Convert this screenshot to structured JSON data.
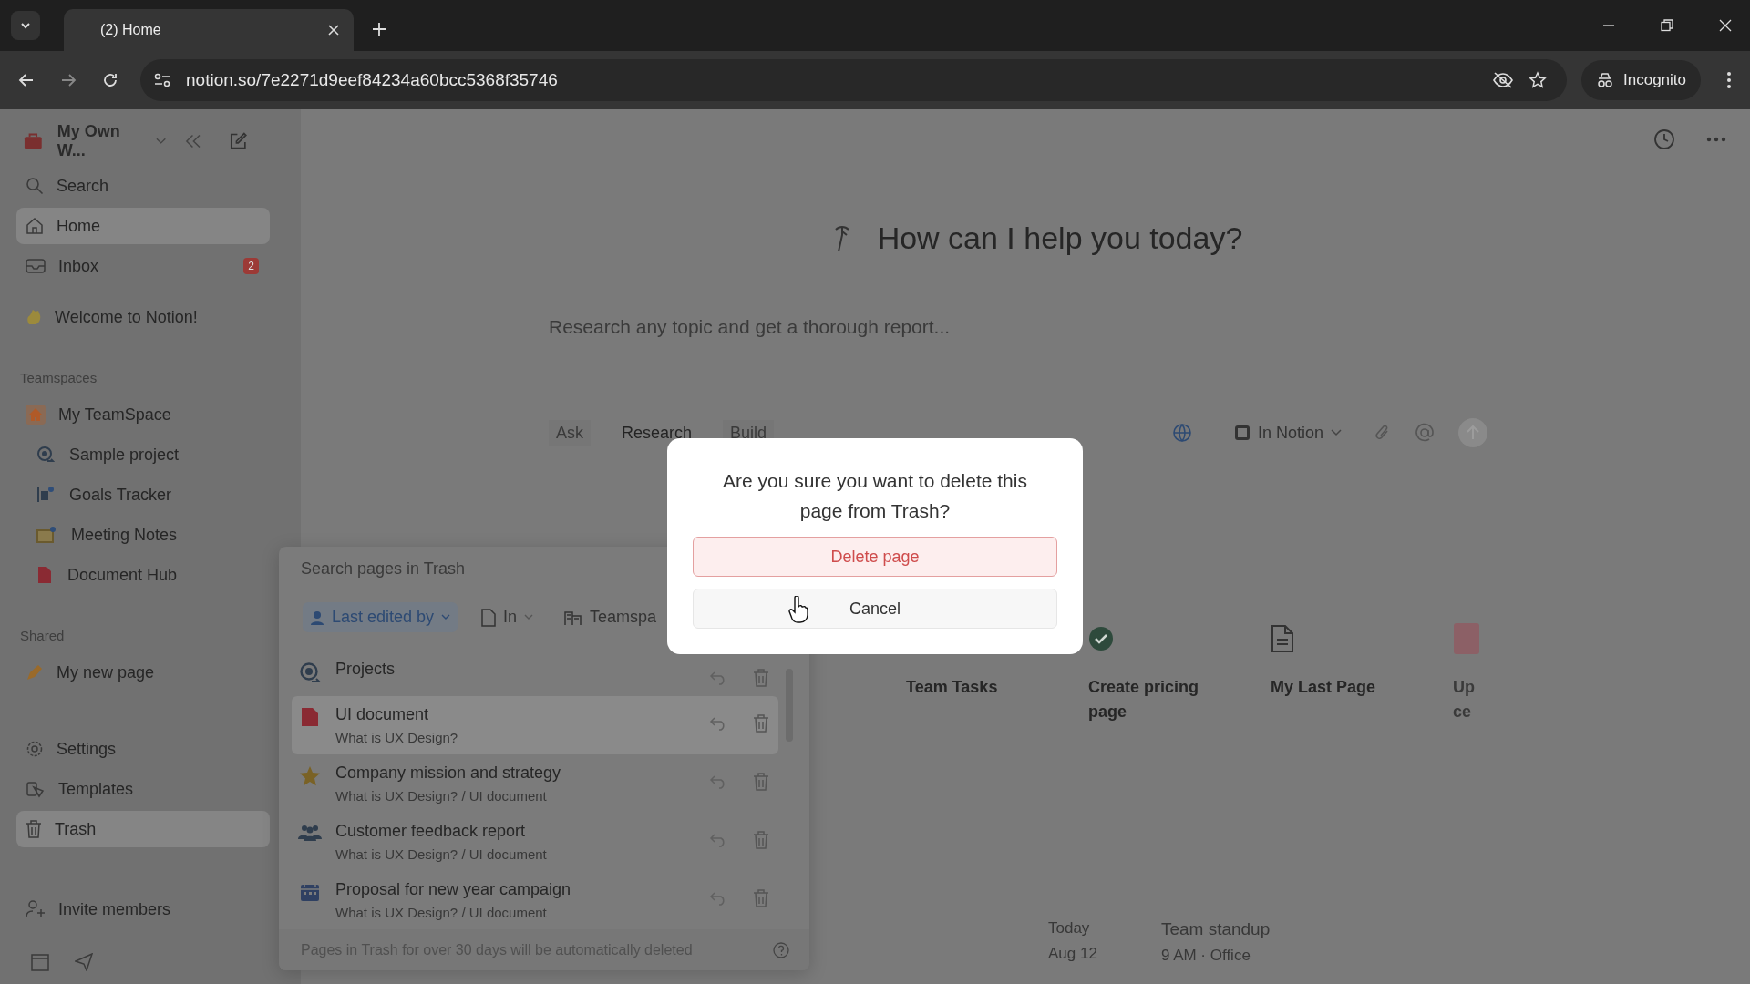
{
  "browser": {
    "tab_title": "(2) Home",
    "url": "notion.so/7e2271d9eef84234a60bcc5368f35746",
    "profile": "Incognito"
  },
  "sidebar": {
    "workspace": "My Own W...",
    "nav": [
      {
        "label": "Search",
        "selected": false
      },
      {
        "label": "Home",
        "selected": true
      },
      {
        "label": "Inbox",
        "selected": false,
        "badge": "2"
      }
    ],
    "pinned": [
      "Welcome to Notion!"
    ],
    "teamspaces": {
      "heading": "Teamspaces",
      "items": [
        {
          "label": "My TeamSpace",
          "children": [
            {
              "label": "Sample project"
            },
            {
              "label": "Goals Tracker"
            },
            {
              "label": "Meeting Notes"
            },
            {
              "label": "Document Hub"
            }
          ]
        }
      ]
    },
    "shared": {
      "heading": "Shared",
      "items": [
        "My new page"
      ]
    },
    "bottom": [
      {
        "label": "Settings",
        "selected": false
      },
      {
        "label": "Templates",
        "selected": false
      },
      {
        "label": "Trash",
        "selected": true
      }
    ],
    "invite": "Invite members"
  },
  "main": {
    "title": "How can I help you today?",
    "prompt": {
      "placeholder": "Research any topic and get a thorough report..."
    },
    "modes": [
      {
        "label": "Ask",
        "selected": false
      },
      {
        "label": "Research",
        "selected": true
      },
      {
        "label": "Build",
        "selected": false
      }
    ],
    "scope": "In Notion",
    "cards": [
      {
        "title_lines": [
          "Team Tasks"
        ]
      },
      {
        "title_lines": [
          "Create pricing",
          "page"
        ]
      },
      {
        "title_lines": [
          "My Last Page"
        ]
      },
      {
        "title_lines": [
          "Up",
          "ce"
        ]
      }
    ],
    "schedule": [
      {
        "day": "Today",
        "date": "Aug 12",
        "event": "Team standup",
        "detail": "9 AM · Office"
      }
    ]
  },
  "trash": {
    "search": {
      "placeholder": "Search pages in Trash"
    },
    "filters": [
      {
        "label": "Last edited by",
        "active": true
      },
      {
        "label": "In",
        "active": false
      },
      {
        "label": "Teamspa",
        "active": false
      }
    ],
    "pages": [
      {
        "title": "Projects",
        "selected": false
      },
      {
        "title": "UI document",
        "path": "What is UX Design?",
        "selected": true
      },
      {
        "title": "Company mission and strategy",
        "path": "What is UX Design? / UI document",
        "selected": false
      },
      {
        "title": "Customer feedback report",
        "path": "What is UX Design? / UI document",
        "selected": false
      },
      {
        "title": "Proposal for new year campaign",
        "path": "What is UX Design? / UI document",
        "selected": false
      }
    ],
    "footer": "Pages in Trash for over 30 days will be automatically deleted"
  },
  "dialog": {
    "message": "Are you sure you want to delete this page from Trash?",
    "confirm": "Delete page",
    "cancel": "Cancel"
  }
}
